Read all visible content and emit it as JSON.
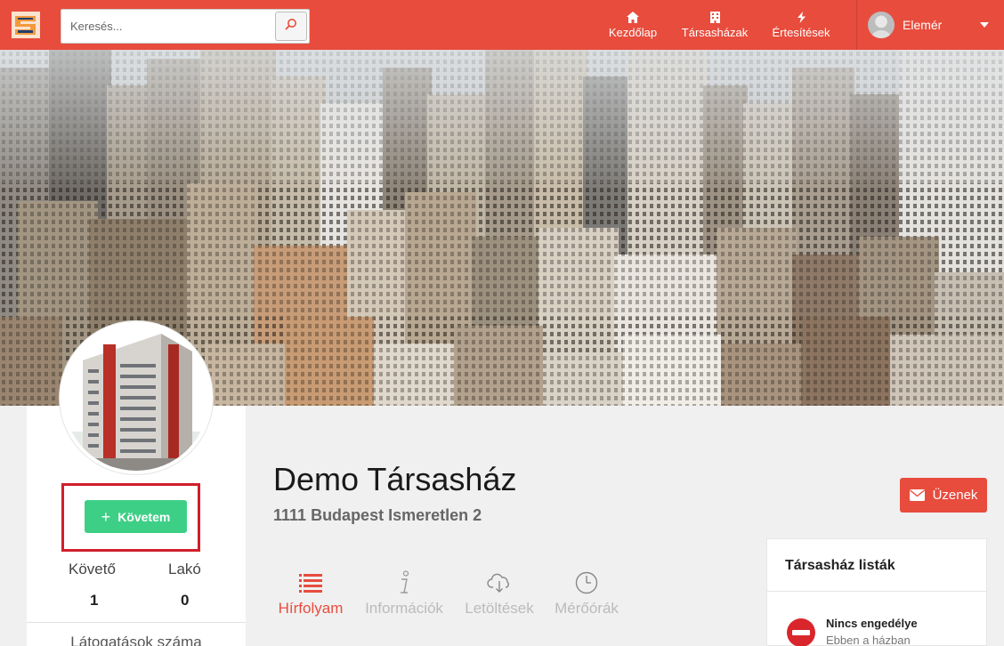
{
  "header": {
    "search": {
      "placeholder": "Keresés..."
    },
    "nav": [
      {
        "label": "Kezdőlap",
        "icon": "home-icon"
      },
      {
        "label": "Társasházak",
        "icon": "building-icon"
      },
      {
        "label": "Értesítések",
        "icon": "bolt-icon"
      }
    ],
    "user": {
      "name": "Elemér"
    }
  },
  "profile": {
    "follow_label": "Követem",
    "stats": [
      {
        "label": "Követő",
        "value": "1"
      },
      {
        "label": "Lakó",
        "value": "0"
      }
    ],
    "visits_label": "Látogatások száma"
  },
  "main": {
    "title": "Demo Társasház",
    "address": "1111 Budapest Ismeretlen 2",
    "tabs": [
      {
        "label": "Hírfolyam",
        "icon": "list-icon",
        "active": true
      },
      {
        "label": "Információk",
        "icon": "info-icon",
        "active": false
      },
      {
        "label": "Letöltések",
        "icon": "cloud-download-icon",
        "active": false
      },
      {
        "label": "Mérőórák",
        "icon": "clock-icon",
        "active": false
      }
    ]
  },
  "sidebar": {
    "messages_label": "Üzenek",
    "lists_title": "Társasház listák",
    "permission_title": "Nincs engedélye",
    "permission_sub": "Ebben a házban"
  },
  "colors": {
    "accent": "#e84c3d",
    "follow": "#3ecf86",
    "highlight": "#d11e2b"
  }
}
